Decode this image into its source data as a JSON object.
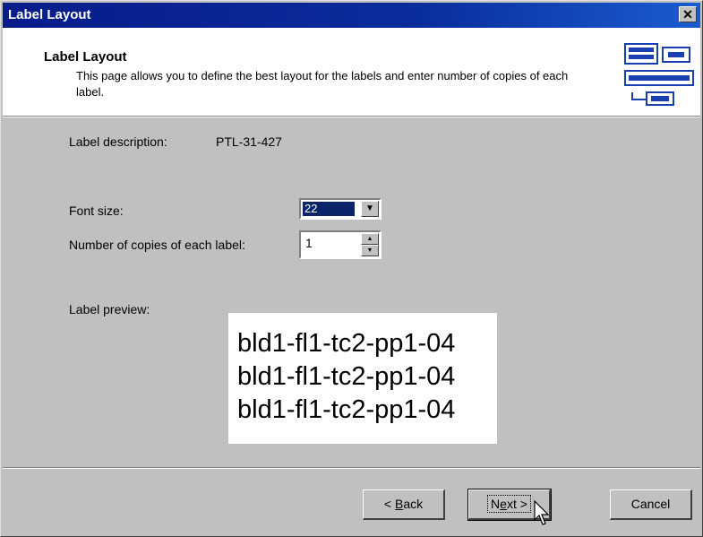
{
  "window": {
    "title": "Label Layout",
    "close_label": "✕"
  },
  "header": {
    "title": "Label Layout",
    "description": "This page allows you to define the best layout for the labels and enter number of copies of each label.",
    "icon_name": "label-sheet-icon"
  },
  "form": {
    "description_label": "Label description:",
    "description_value": "PTL-31-427",
    "font_size_label": "Font size:",
    "font_size_value": "22",
    "copies_label": "Number of copies of each label:",
    "copies_value": "1",
    "preview_label": "Label preview:"
  },
  "preview": {
    "lines": [
      "bld1-fl1-tc2-pp1-04",
      "bld1-fl1-tc2-pp1-04",
      "bld1-fl1-tc2-pp1-04"
    ]
  },
  "buttons": {
    "back_prefix": "< ",
    "back_accel": "B",
    "back_rest": "ack",
    "next_prefix": "N",
    "next_accel": "e",
    "next_rest": "xt >",
    "cancel": "Cancel"
  },
  "colors": {
    "title_bar": "#0a246a",
    "selection": "#0a246a",
    "face": "#c0c0c0"
  }
}
